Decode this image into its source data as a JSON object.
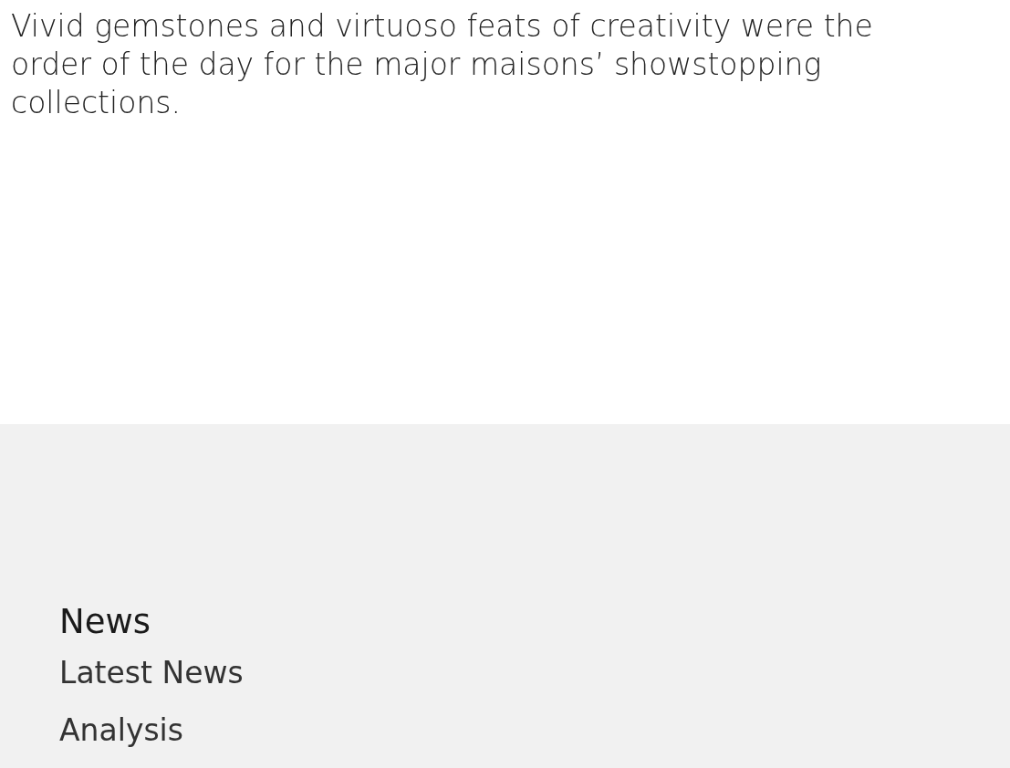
{
  "intro": "Vivid gemstones and virtuoso feats of creativity were the order of the day for the major maisons’ showstopping collections.",
  "footer": {
    "heading": "News",
    "links": [
      "Latest News",
      "Analysis"
    ]
  }
}
